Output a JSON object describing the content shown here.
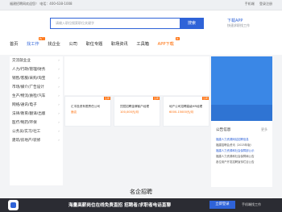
{
  "topbar": {
    "left": "福建招聘网欢迎您！ 电话：400-638-1008",
    "right_links": [
      "手机端",
      "登录注册"
    ]
  },
  "search": {
    "placeholder": "请输入职位搜索职位关键字",
    "button": "搜索"
  },
  "app_download": {
    "label": "下载APP",
    "sub": "快速求职找工作"
  },
  "nav": [
    {
      "label": "首页",
      "active": false
    },
    {
      "label": "找工作",
      "active": true,
      "badge": "热门"
    },
    {
      "label": "找企业",
      "active": false
    },
    {
      "label": "公司",
      "active": false
    },
    {
      "label": "职位专题",
      "active": false
    },
    {
      "label": "职场资讯",
      "active": false
    },
    {
      "label": "工具箱",
      "active": false
    },
    {
      "label": "APP下载",
      "active": false,
      "badge": "新"
    }
  ],
  "categories": [
    "交流就业业",
    "人力/行政/管理/财务",
    "销售/客服/采购/淘宝",
    "市场/媒介/广告设计",
    "生产/物流/质检/汽车",
    "网络/通讯/电子",
    "法律/教育/翻译/出版",
    "医疗/制药/环保",
    "公务员/实习/社工",
    "建筑/房地产/装修"
  ],
  "cards": [
    {
      "tag": "急聘",
      "title": "汇丰投资有限责任公司",
      "price": "面议"
    },
    {
      "tag": "急聘",
      "title": "顶层招聘金牌客户经理",
      "price": "100,000元/月"
    },
    {
      "tag": "急聘",
      "title": "地产公司招聘高级HR经理",
      "price": "6000-15000元/月"
    }
  ],
  "notice": {
    "title": "公告信息",
    "more": "更多",
    "lines": [
      "福建人力资源网站招聘信息",
      "福建招聘会资讯（2025年版）",
      "福建人力资源和社会保障部公示",
      "福建人力资源和社会保障局公告",
      "各位用户开发招聘宣传栏目公告"
    ]
  },
  "section_title": "名企招聘",
  "footer": {
    "text": "海量高薪岗位在线免费直招 招聘者/求职者电话直聊",
    "button": "立即登录",
    "link": "手机端找工作"
  }
}
